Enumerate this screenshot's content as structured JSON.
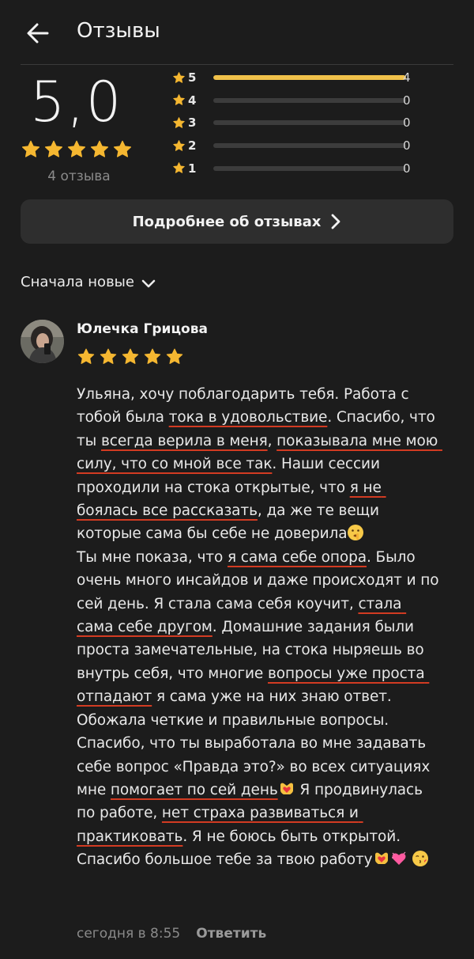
{
  "header": {
    "title": "Отзывы"
  },
  "rating": {
    "score": "5,0",
    "count_label": "4 отзыва",
    "stars": 5,
    "distribution": [
      {
        "label": "5",
        "count": "4",
        "fraction": 1.0
      },
      {
        "label": "4",
        "count": "0",
        "fraction": 0
      },
      {
        "label": "3",
        "count": "0",
        "fraction": 0
      },
      {
        "label": "2",
        "count": "0",
        "fraction": 0
      },
      {
        "label": "1",
        "count": "0",
        "fraction": 0
      }
    ]
  },
  "more_button": {
    "label": "Подробнее об отзывах"
  },
  "sort": {
    "label": "Сначала новые"
  },
  "review": {
    "author": "Юлечка Грицова",
    "stars": 5,
    "segments": [
      {
        "t": "Ульяна, хочу поблагодарить тебя. Работа с тобой была "
      },
      {
        "t": "тока в удовольствие",
        "u": true
      },
      {
        "t": ". Спасибо, что ты "
      },
      {
        "t": "всегда верила в меня",
        "u": true
      },
      {
        "t": ", "
      },
      {
        "t": "показывала мне мою силу, что со мной все так",
        "u": true
      },
      {
        "t": ". Наши сессии проходили на стока открытые, что "
      },
      {
        "t": "я не боялась все рассказать",
        "u": true
      },
      {
        "t": ", да же те вещи которые сама бы себе не доверила"
      },
      {
        "e": "shush"
      },
      {
        "t": "\nТы мне показа, что "
      },
      {
        "t": "я сама себе опора",
        "u": true
      },
      {
        "t": ". Было очень много инсайдов и даже происходят и по сей день. Я стала сама себя коучит, "
      },
      {
        "t": "стала сама себе другом",
        "u": true
      },
      {
        "t": ". Домашние задания были проста замечательные, на стока ныряешь во внутрь себя, что многие "
      },
      {
        "t": "вопросы уже проста отпадают",
        "u": true
      },
      {
        "t": " я сама уже на них знаю ответ. Обожала четкие и правильные вопросы. Спасибо, что ты выработала во мне задавать себе вопрос «Правда это?» во всех ситуациях мне "
      },
      {
        "t": "помогает по сей день",
        "u": true
      },
      {
        "e": "heart-hands"
      },
      {
        "t": " Я продвинулась по работе, "
      },
      {
        "t": "нет страха развиваться и практиковать",
        "u": true
      },
      {
        "t": ". Я не боюсь быть открытой. Спасибо большое тебе за твою работу"
      },
      {
        "e": "heart-hands"
      },
      {
        "e": "pink-heart"
      },
      {
        "t": " "
      },
      {
        "e": "kiss-face"
      }
    ],
    "time": "сегодня в 8:55",
    "reply_label": "Ответить"
  },
  "colors": {
    "background": "#1c1c1c",
    "star": "#f5b731",
    "bar_fill": "#f0c14a",
    "underline": "#d23b22"
  },
  "icons": [
    "arrow-left-icon",
    "star-icon",
    "chevron-right-icon",
    "chevron-down-icon",
    "avatar"
  ]
}
